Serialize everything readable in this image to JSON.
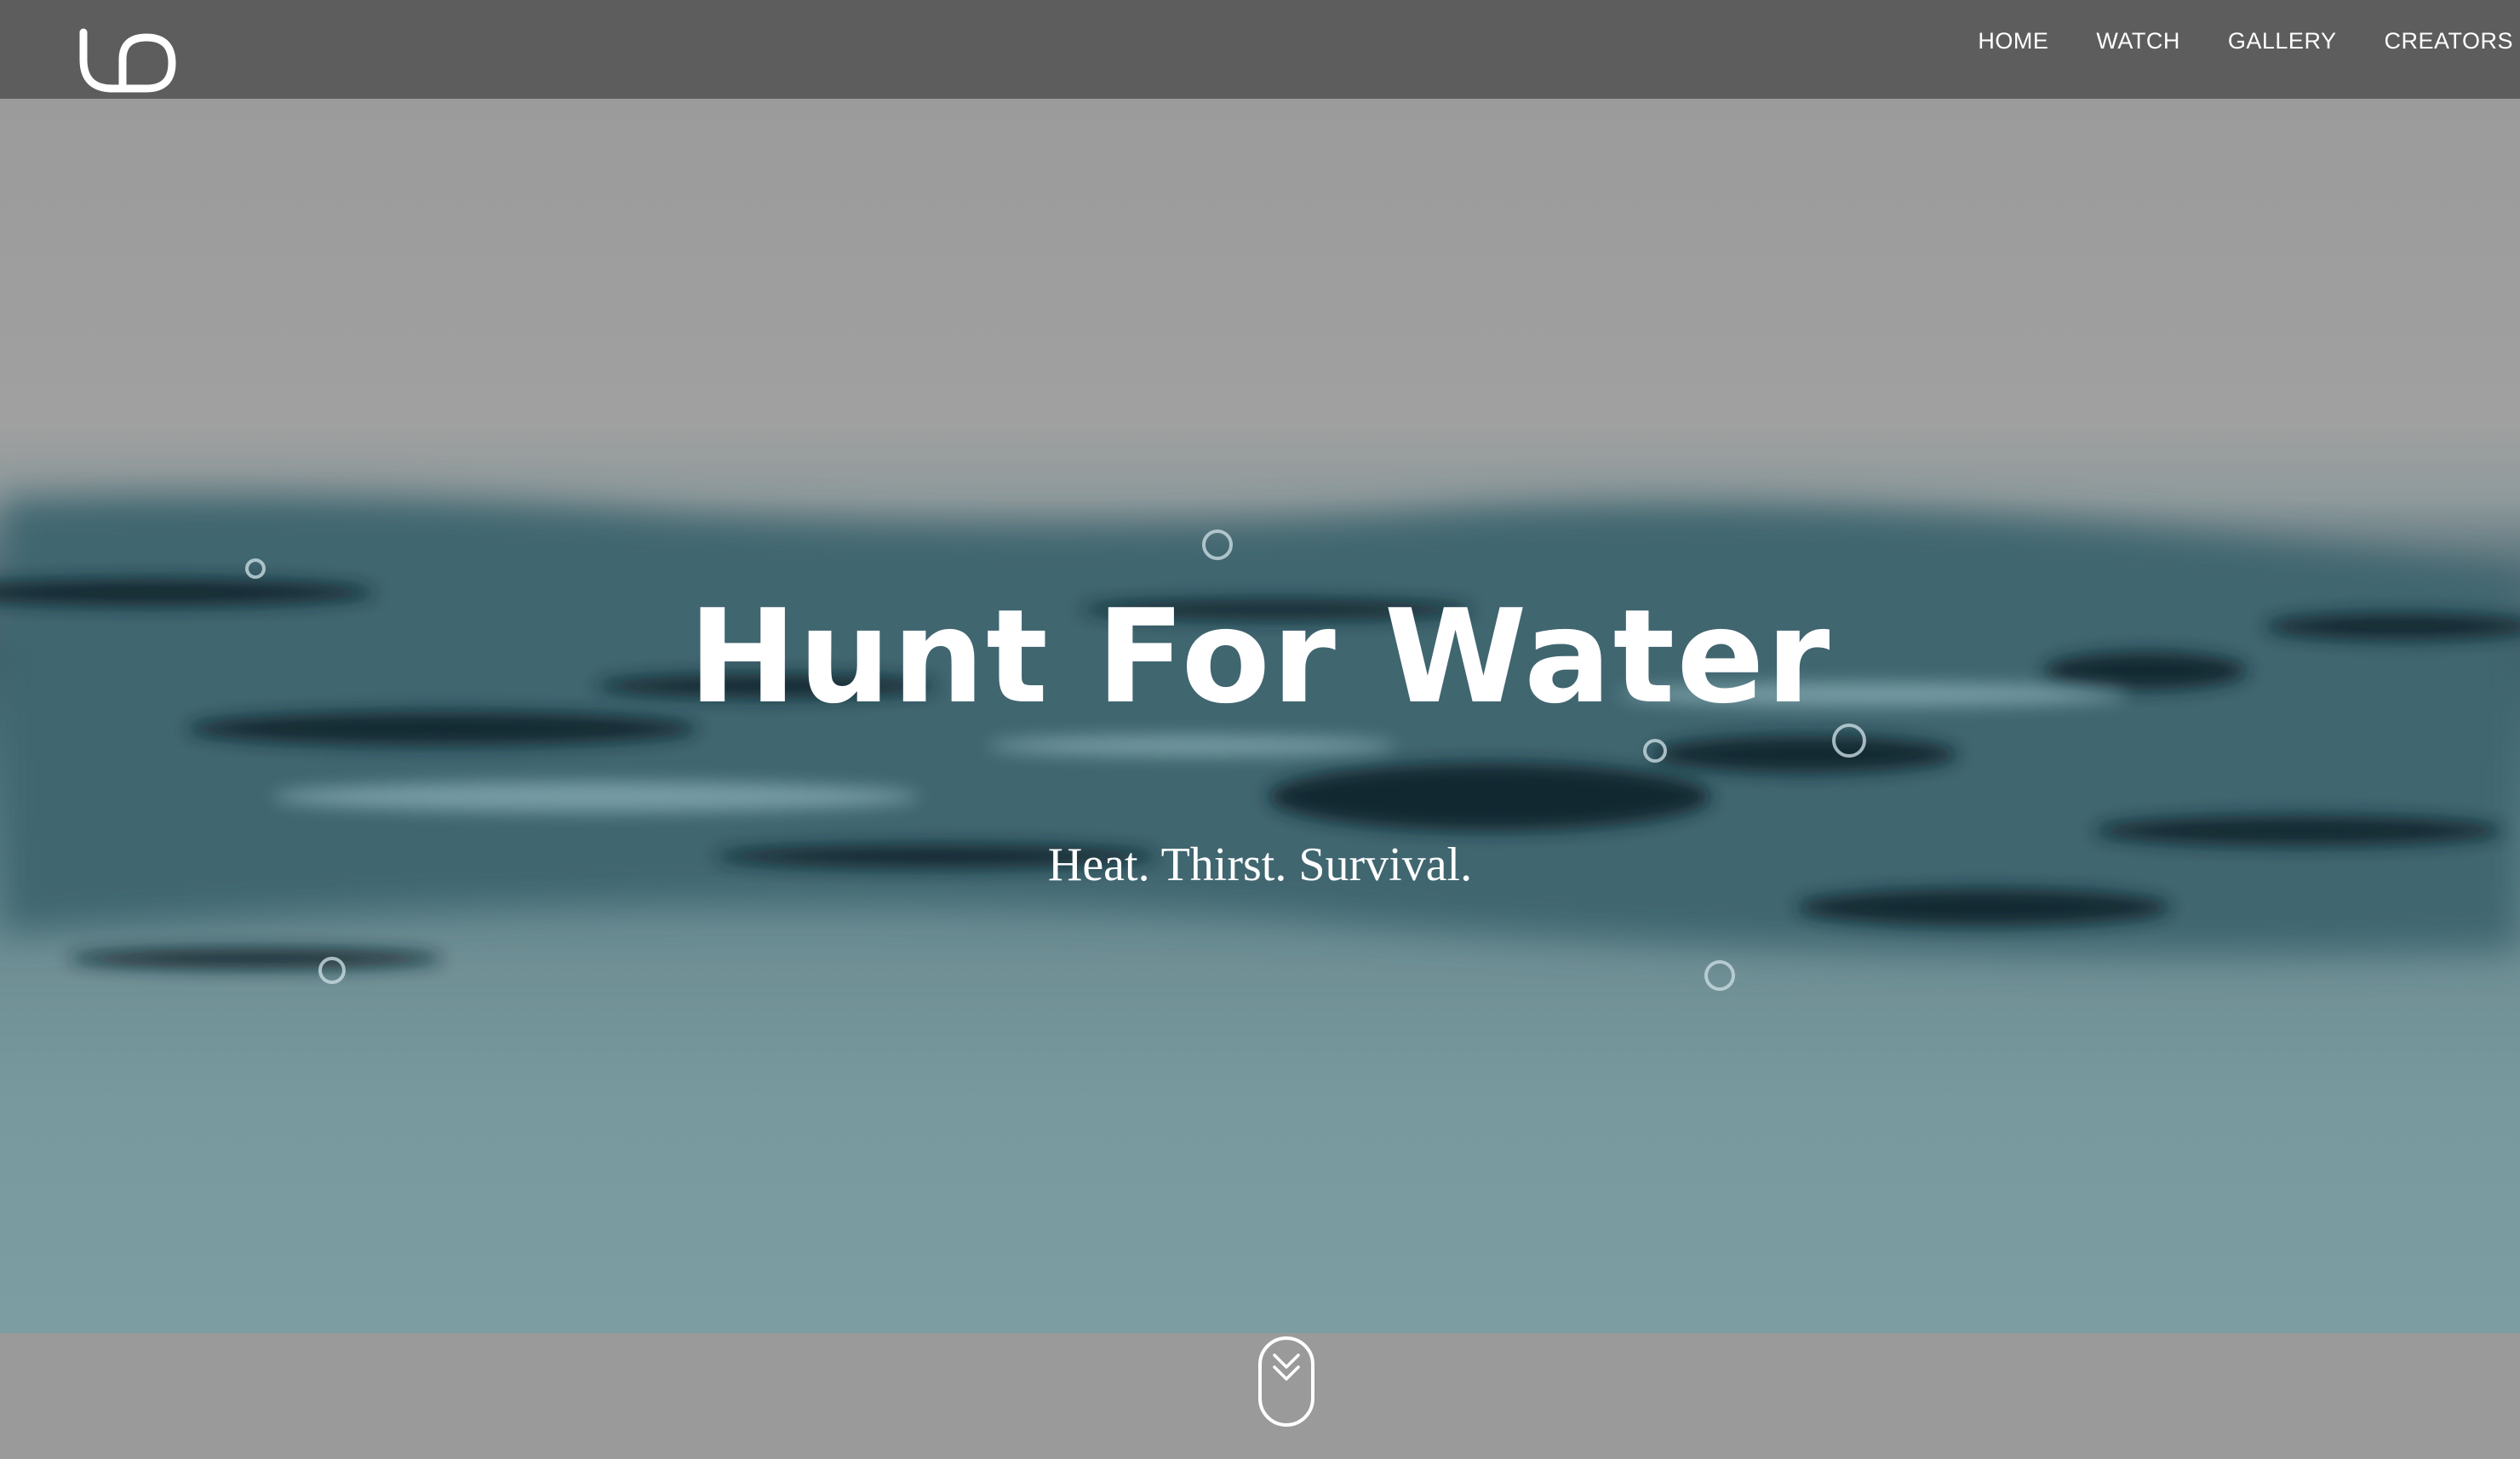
{
  "header": {
    "logo_icon": "ud-logo-icon",
    "nav": [
      {
        "label": "HOME"
      },
      {
        "label": "WATCH"
      },
      {
        "label": "GALLERY"
      },
      {
        "label": "CREATORS"
      }
    ]
  },
  "hero": {
    "title": "Hunt For Water",
    "tagline": "Heat. Thirst. Survival.",
    "scroll_icon": "chevron-double-down-icon"
  },
  "colors": {
    "navbar": "#5d5d5d",
    "text": "#ffffff",
    "page_background": "#9a9a9a",
    "water_accent": "#3e5f69"
  }
}
